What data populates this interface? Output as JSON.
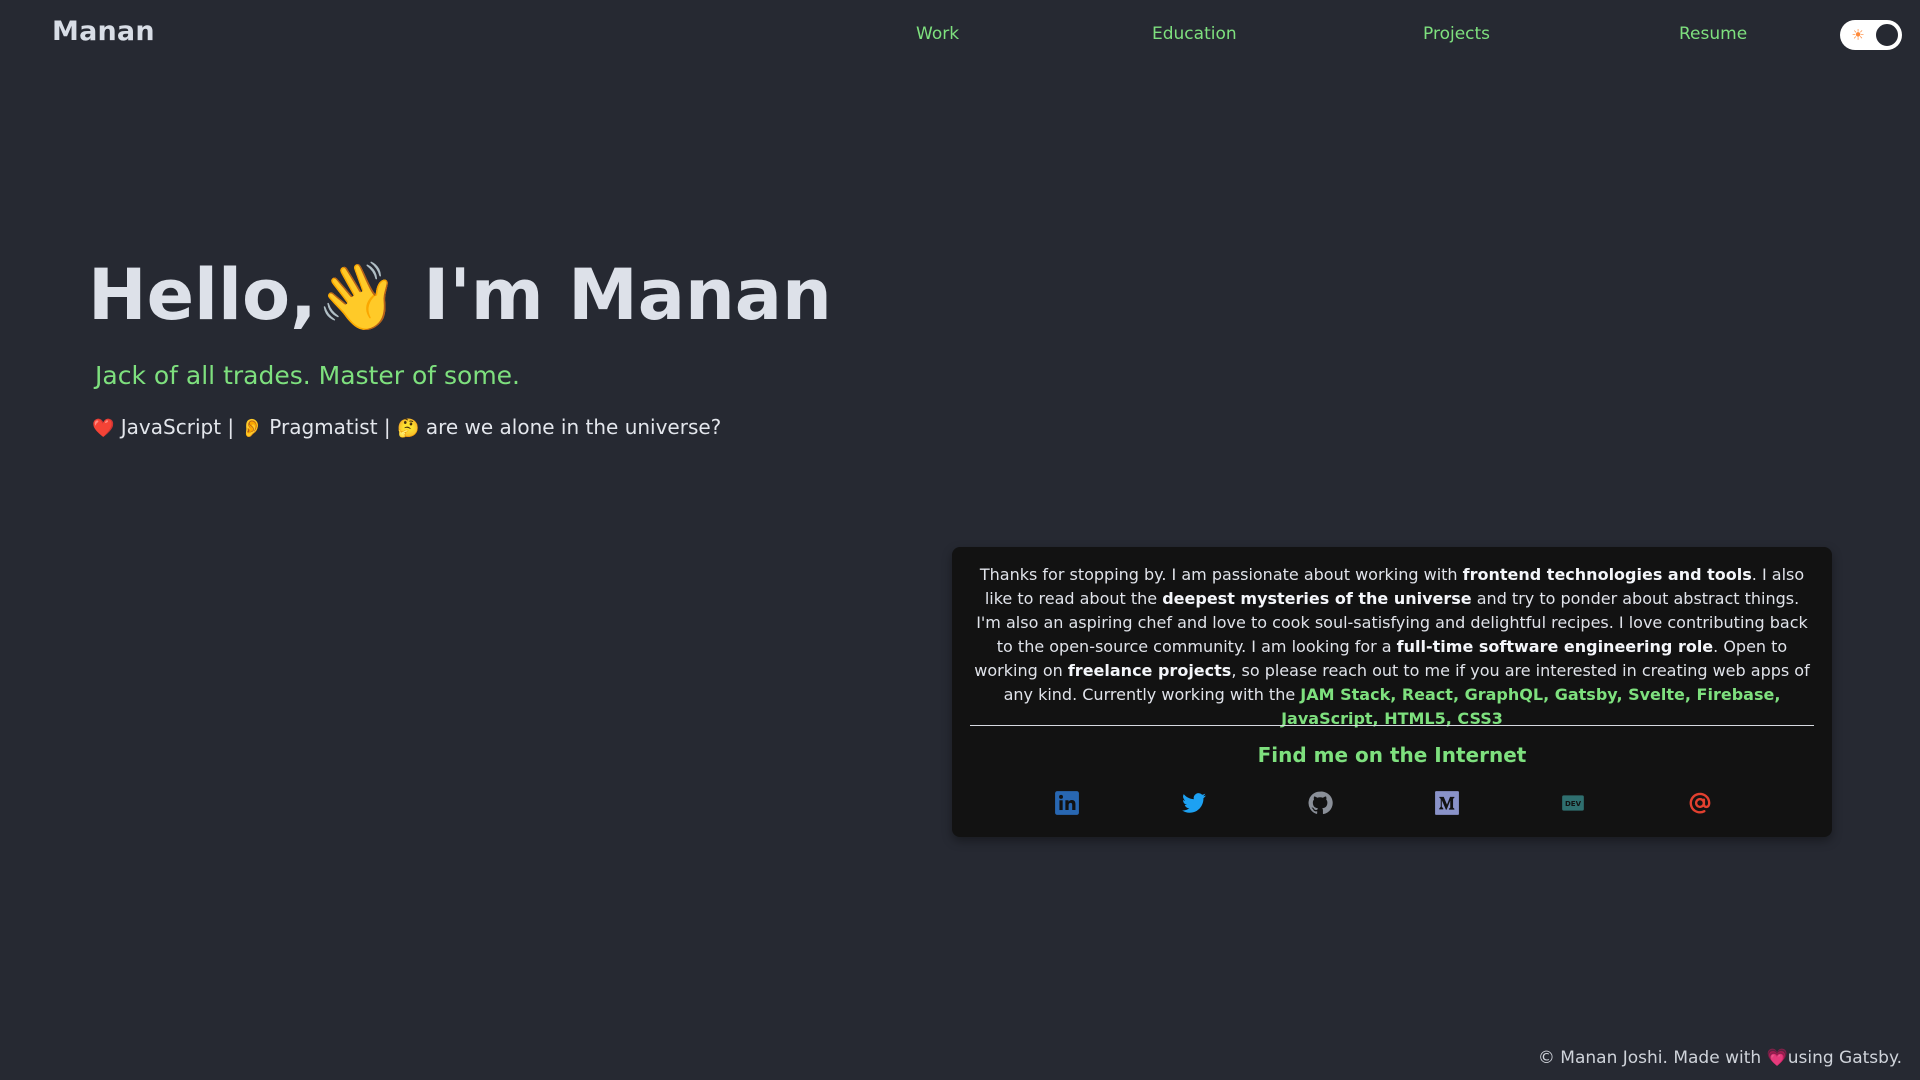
{
  "header": {
    "brand": "Manan",
    "nav": [
      {
        "label": "Work"
      },
      {
        "label": "Education"
      },
      {
        "label": "Projects"
      },
      {
        "label": "Resume"
      }
    ],
    "theme_toggle": {
      "icon": "sun-icon",
      "state": "light",
      "glyph": "☀"
    }
  },
  "hero": {
    "title_before": "Hello,",
    "wave_emoji": "👋",
    "title_after": " I'm Manan",
    "tagline": "Jack of all trades. Master of some.",
    "interests": [
      {
        "emoji": "❤️",
        "text": "JavaScript |"
      },
      {
        "emoji": "👂",
        "text": "Pragmatist |"
      },
      {
        "emoji": "🤔",
        "text": "are we alone in the universe?"
      }
    ]
  },
  "about": {
    "p1": "Thanks for stopping by. I am passionate about working with ",
    "b1": "frontend technologies and tools",
    "p2": ". I also like to read about the ",
    "b2": "deepest mysteries of the universe",
    "p3": " and try to ponder about abstract things. I'm also an aspiring chef and love to cook soul-satisfying and delightful recipes. I love contributing back to the open-source community. I am looking for a ",
    "b3": "full-time software engineering role",
    "p4": ". Open to working on ",
    "b4": "freelance projects",
    "p5": ", so please reach out to me if you are interested in creating web apps of any kind. Currently working with the ",
    "tech": "JAM Stack, React, GraphQL, Gatsby, Svelte, Firebase, JavaScript, HTML5, CSS3",
    "find_title": "Find me on the Internet",
    "social": [
      {
        "name": "linkedin-icon",
        "color": "#0e76a8"
      },
      {
        "name": "twitter-icon",
        "color": "#1da1f2"
      },
      {
        "name": "github-icon",
        "color": "#8a8f98"
      },
      {
        "name": "medium-icon",
        "color": "#8a93c9"
      },
      {
        "name": "dev-icon",
        "color": "#2f6f6f"
      },
      {
        "name": "email-icon",
        "color": "#e2402f"
      }
    ]
  },
  "footer": {
    "prefix": "© Manan Joshi. Made with ",
    "heart": "💗",
    "suffix": "using Gatsby."
  },
  "colors": {
    "background": "#262932",
    "accent": "#7ee07e",
    "card": "#121212"
  }
}
